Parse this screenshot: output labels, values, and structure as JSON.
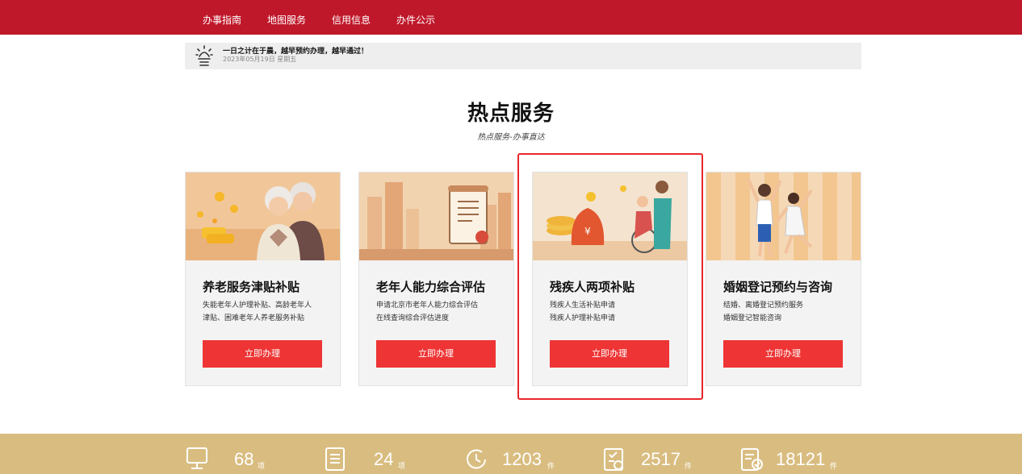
{
  "nav": {
    "items": [
      {
        "label": "办事指南"
      },
      {
        "label": "地图服务"
      },
      {
        "label": "信用信息"
      },
      {
        "label": "办件公示"
      }
    ]
  },
  "notice": {
    "text": "一日之计在于晨，越早预约办理，越早通过！",
    "date": "2023年05月19日 星期五"
  },
  "section": {
    "title": "热点服务",
    "subtitle": "热点服务-办事直达"
  },
  "cards": [
    {
      "title": "养老服务津贴补贴",
      "desc1": "失能老年人护理补贴、高龄老年人",
      "desc2": "津贴、困难老年人养老服务补贴",
      "button": "立即办理"
    },
    {
      "title": "老年人能力综合评估",
      "desc1": "申请北京市老年人能力综合评估",
      "desc2": "在线查询综合评估进度",
      "button": "立即办理"
    },
    {
      "title": "残疾人两项补贴",
      "desc1": "残疾人生活补贴申请",
      "desc2": "残疾人护理补贴申请",
      "button": "立即办理"
    },
    {
      "title": "婚姻登记预约与咨询",
      "desc1": "结婚、离婚登记预约服务",
      "desc2": "婚姻登记智能咨询",
      "button": "立即办理"
    }
  ],
  "stats": [
    {
      "value": "68",
      "unit": "项",
      "icon": "computer-icon"
    },
    {
      "value": "24",
      "unit": "项",
      "icon": "document-list-icon"
    },
    {
      "value": "1203",
      "unit": "件",
      "icon": "refresh-clock-icon"
    },
    {
      "value": "2517",
      "unit": "件",
      "icon": "clipboard-check-icon"
    },
    {
      "value": "18121",
      "unit": "件",
      "icon": "form-done-icon"
    }
  ],
  "colors": {
    "nav_bg": "#c0182b",
    "button": "#ee3434",
    "highlight_border": "#e8262b",
    "stats_bg": "#d9bd80"
  }
}
